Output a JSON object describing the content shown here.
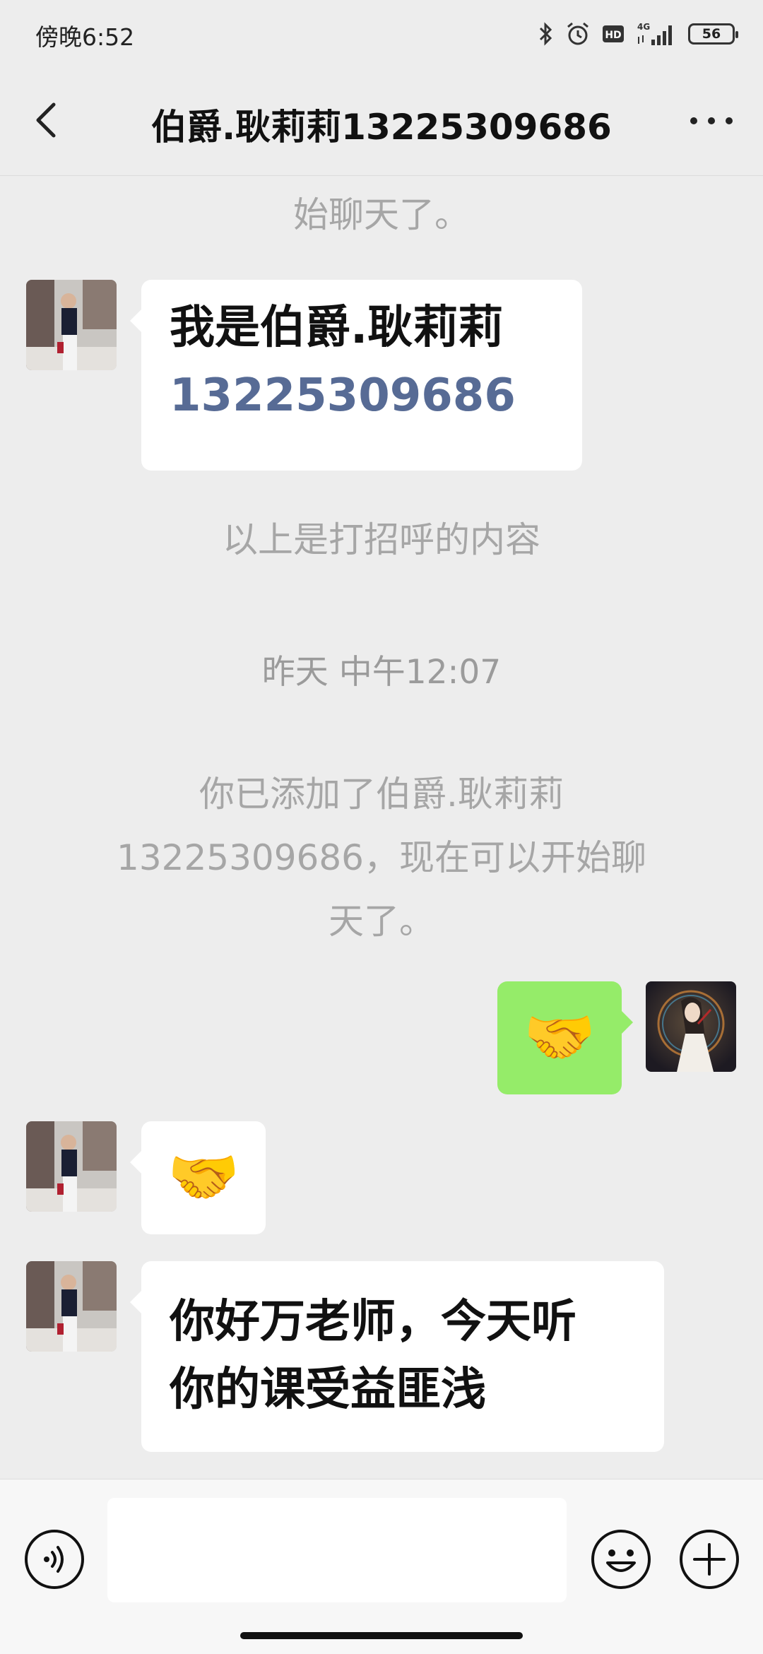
{
  "status_bar": {
    "time": "傍晚6:52",
    "battery": "56"
  },
  "header": {
    "title": "伯爵.耿莉莉13225309686"
  },
  "messages": {
    "sys_partial": "始聊天了。",
    "m1_line1": "我是伯爵.耿莉莉",
    "m1_line2": "13225309686",
    "greeting_note": "以上是打招呼的内容",
    "timestamp": "昨天 中午12:07",
    "added_line1": "你已添加了伯爵.耿莉莉",
    "added_line2": "13225309686，现在可以开始聊",
    "added_line3": "天了。",
    "m2_emoji": "🤝",
    "m3_emoji": "🤝",
    "m4_line1": "你好万老师，今天听",
    "m4_line2": "你的课受益匪浅"
  },
  "icons": {
    "back": "back-arrow-icon",
    "more": "more-dots-icon",
    "voice": "voice-icon",
    "emoji": "smiley-icon",
    "plus": "plus-icon"
  },
  "colors": {
    "background": "#ededed",
    "out_bubble": "#95ec69",
    "in_bubble": "#ffffff",
    "link": "#576b95"
  }
}
